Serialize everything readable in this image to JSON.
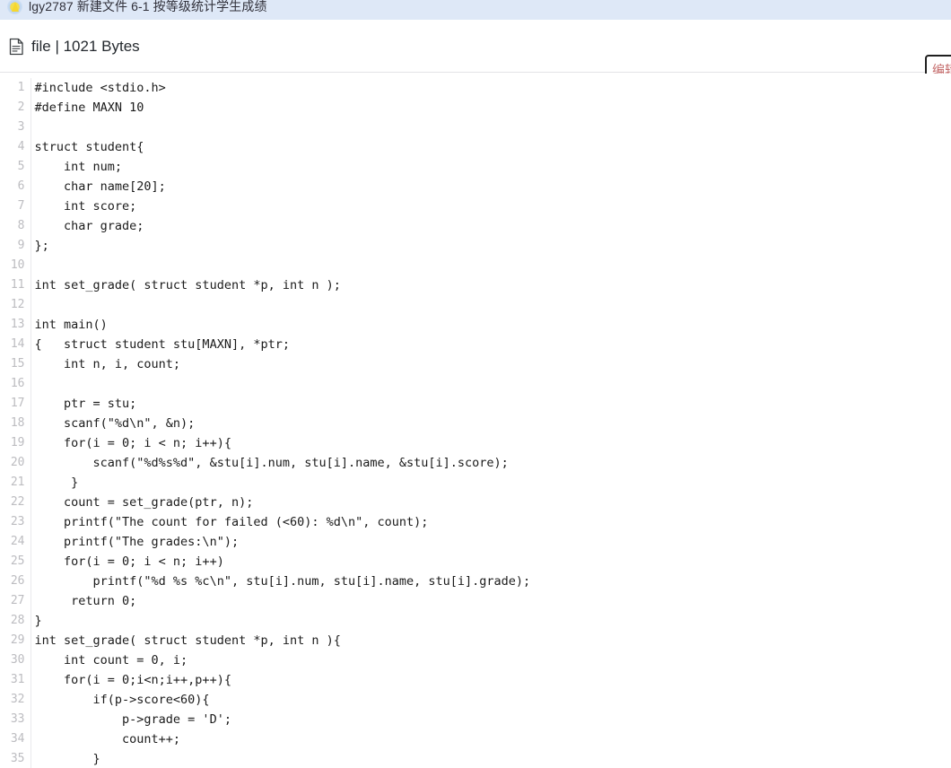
{
  "browser": {
    "tab": {
      "favicon": "document-star-icon",
      "title": "lgy2787 新建文件 6-1 按等级统计学生成绩"
    }
  },
  "file_header": {
    "icon": "file-document-icon",
    "label": "file | 1021 Bytes",
    "name": "file",
    "size": "1021 Bytes",
    "edit_button_label": "编辑"
  },
  "colors": {
    "tabstrip_bg": "#dee8f7",
    "header_bg": "#ffffff",
    "code_bg": "#ffffff",
    "code_text": "#1b1b1b",
    "line_number": "#bcbcc0",
    "gutter_border": "#e9e9ec",
    "button_border": "#1f1f1f"
  },
  "code": {
    "language": "c",
    "first_line": 1,
    "lines": [
      "#include <stdio.h>",
      "#define MAXN 10",
      "",
      "struct student{",
      "    int num;",
      "    char name[20];",
      "    int score;",
      "    char grade;",
      "};",
      "",
      "int set_grade( struct student *p, int n );",
      "",
      "int main()",
      "{   struct student stu[MAXN], *ptr;",
      "    int n, i, count;",
      "",
      "    ptr = stu;",
      "    scanf(\"%d\\n\", &n);",
      "    for(i = 0; i < n; i++){",
      "        scanf(\"%d%s%d\", &stu[i].num, stu[i].name, &stu[i].score);",
      "     }",
      "    count = set_grade(ptr, n);",
      "    printf(\"The count for failed (<60): %d\\n\", count);",
      "    printf(\"The grades:\\n\");",
      "    for(i = 0; i < n; i++)",
      "        printf(\"%d %s %c\\n\", stu[i].num, stu[i].name, stu[i].grade);",
      "     return 0;",
      "}",
      "int set_grade( struct student *p, int n ){",
      "    int count = 0, i;",
      "    for(i = 0;i<n;i++,p++){",
      "        if(p->score<60){",
      "            p->grade = 'D';",
      "            count++;",
      "        }"
    ]
  }
}
